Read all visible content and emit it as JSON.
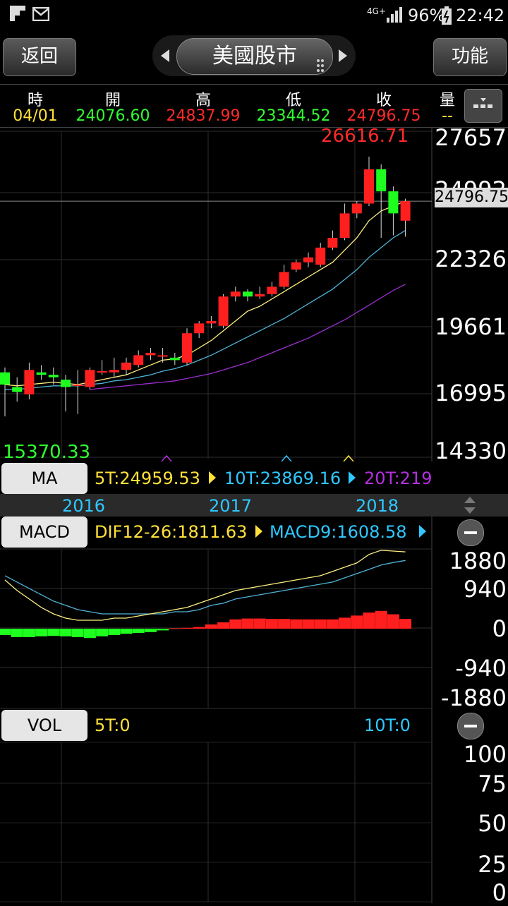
{
  "status": {
    "signal": "4G+",
    "battery": "96%",
    "time": "22:42"
  },
  "nav": {
    "back_label": "返回",
    "title": "美國股市",
    "menu_label": "功能"
  },
  "quote": {
    "headers": [
      "時",
      "開",
      "高",
      "低",
      "收",
      "量"
    ],
    "values": [
      "04/01",
      "24076.60",
      "24837.99",
      "23344.52",
      "24796.75",
      "--"
    ]
  },
  "price_axis": [
    "27657",
    "24992",
    "22326",
    "19661",
    "16995",
    "14330"
  ],
  "current_price": "24796.75",
  "high_label": "26616.71",
  "low_label": "15370.33",
  "ma": {
    "button": "MA",
    "t5": "5T:24959.53",
    "t10": "10T:23869.16",
    "t20": "20T:219"
  },
  "years": [
    "2016",
    "2017",
    "2018"
  ],
  "macd": {
    "button": "MACD",
    "dif": "DIF12-26:1811.63",
    "macd9": "MACD9:1608.58"
  },
  "macd_axis": [
    "1880",
    "940",
    "0",
    "-940",
    "-1880"
  ],
  "vol": {
    "button": "VOL",
    "t5": "5T:0",
    "t10": "10T:0"
  },
  "vol_axis": [
    "100",
    "75",
    "50",
    "25",
    "0"
  ],
  "colors": {
    "up": "#ff1f1f",
    "down": "#1fff1f",
    "ma5": "#ffef80",
    "ma10": "#4fb4d8",
    "ma20": "#9b2fd0",
    "yellow": "#ffe13a",
    "cyan": "#2fc8ff",
    "purple": "#b42fe0"
  },
  "chart_data": {
    "type": "candlestick",
    "title": "",
    "ylim": [
      14330,
      27657
    ],
    "candles": [
      {
        "open": 17800,
        "close": 17300,
        "high": 18000,
        "low": 16000
      },
      {
        "open": 17200,
        "close": 17000,
        "high": 17600,
        "low": 16600
      },
      {
        "open": 16900,
        "close": 17900,
        "high": 18200,
        "low": 16700
      },
      {
        "open": 17800,
        "close": 17700,
        "high": 18100,
        "low": 17500
      },
      {
        "open": 17700,
        "close": 17600,
        "high": 18000,
        "low": 17300
      },
      {
        "open": 17500,
        "close": 17200,
        "high": 17700,
        "low": 16200
      },
      {
        "open": 17300,
        "close": 17300,
        "high": 17900,
        "low": 16100
      },
      {
        "open": 17200,
        "close": 17900,
        "high": 18000,
        "low": 17100
      },
      {
        "open": 17800,
        "close": 17850,
        "high": 18300,
        "low": 17700
      },
      {
        "open": 17800,
        "close": 17900,
        "high": 18400,
        "low": 17600
      },
      {
        "open": 17900,
        "close": 18200,
        "high": 18400,
        "low": 17700
      },
      {
        "open": 18100,
        "close": 18500,
        "high": 18700,
        "low": 18000
      },
      {
        "open": 18500,
        "close": 18600,
        "high": 18800,
        "low": 18300
      },
      {
        "open": 18500,
        "close": 18500,
        "high": 18800,
        "low": 18200
      },
      {
        "open": 18400,
        "close": 18300,
        "high": 18600,
        "low": 18100
      },
      {
        "open": 18200,
        "close": 19400,
        "high": 19600,
        "low": 18100
      },
      {
        "open": 19400,
        "close": 19800,
        "high": 19900,
        "low": 19200
      },
      {
        "open": 19800,
        "close": 19900,
        "high": 20100,
        "low": 19600
      },
      {
        "open": 19700,
        "close": 20900,
        "high": 21000,
        "low": 19600
      },
      {
        "open": 20900,
        "close": 21100,
        "high": 21300,
        "low": 20700
      },
      {
        "open": 21100,
        "close": 20900,
        "high": 21200,
        "low": 20700
      },
      {
        "open": 20900,
        "close": 21000,
        "high": 21300,
        "low": 20800
      },
      {
        "open": 21000,
        "close": 21300,
        "high": 21500,
        "low": 20900
      },
      {
        "open": 21300,
        "close": 21900,
        "high": 22200,
        "low": 21200
      },
      {
        "open": 22000,
        "close": 22300,
        "high": 22400,
        "low": 21900
      },
      {
        "open": 22300,
        "close": 22500,
        "high": 22700,
        "low": 22100
      },
      {
        "open": 22200,
        "close": 22900,
        "high": 23100,
        "low": 22100
      },
      {
        "open": 22900,
        "close": 23300,
        "high": 23600,
        "low": 22800
      },
      {
        "open": 23300,
        "close": 24300,
        "high": 24700,
        "low": 23200
      },
      {
        "open": 24300,
        "close": 24700,
        "high": 24800,
        "low": 24100
      },
      {
        "open": 24700,
        "close": 26100,
        "high": 26616,
        "low": 24600
      },
      {
        "open": 26100,
        "close": 25200,
        "high": 26300,
        "low": 23300
      },
      {
        "open": 25200,
        "close": 24300,
        "high": 25400,
        "low": 23400
      },
      {
        "open": 24000,
        "close": 24796,
        "high": 24900,
        "low": 23344
      }
    ],
    "ma5": [
      17300,
      17250,
      17300,
      17350,
      17400,
      17350,
      17300,
      17400,
      17500,
      17600,
      17700,
      17900,
      18100,
      18300,
      18350,
      18500,
      18800,
      19100,
      19500,
      19900,
      20300,
      20500,
      20800,
      21100,
      21400,
      21700,
      22000,
      22300,
      22800,
      23300,
      24000,
      24400,
      24600,
      24800
    ],
    "ma10": [
      17100,
      17100,
      17150,
      17200,
      17250,
      17250,
      17250,
      17300,
      17350,
      17450,
      17500,
      17600,
      17700,
      17850,
      17950,
      18100,
      18300,
      18500,
      18750,
      19000,
      19250,
      19500,
      19750,
      20000,
      20300,
      20600,
      20900,
      21200,
      21600,
      22000,
      22500,
      22900,
      23300,
      23600
    ],
    "ma20": [
      null,
      null,
      null,
      null,
      null,
      null,
      null,
      17100,
      17150,
      17200,
      17250,
      17300,
      17350,
      17400,
      17450,
      17550,
      17650,
      17750,
      17900,
      18050,
      18200,
      18400,
      18600,
      18800,
      19000,
      19200,
      19450,
      19700,
      19950,
      20250,
      20550,
      20850,
      21150,
      21400
    ],
    "macd_ylim": [
      -1880,
      1880
    ],
    "macd_dif": [
      1150,
      900,
      700,
      500,
      350,
      250,
      200,
      200,
      200,
      250,
      250,
      300,
      350,
      400,
      450,
      500,
      600,
      700,
      800,
      900,
      950,
      1000,
      1050,
      1100,
      1150,
      1200,
      1250,
      1350,
      1450,
      1550,
      1750,
      1850,
      1830,
      1811
    ],
    "macd_dea": [
      1250,
      1100,
      950,
      800,
      650,
      550,
      450,
      400,
      350,
      350,
      350,
      350,
      350,
      350,
      400,
      400,
      450,
      550,
      600,
      700,
      750,
      800,
      850,
      900,
      950,
      1000,
      1050,
      1100,
      1200,
      1300,
      1400,
      1500,
      1560,
      1608
    ],
    "macd_hist": [
      -150,
      -200,
      -200,
      -180,
      -170,
      -180,
      -200,
      -220,
      -180,
      -150,
      -120,
      -100,
      -80,
      -40,
      10,
      20,
      40,
      100,
      150,
      220,
      240,
      240,
      230,
      230,
      220,
      220,
      220,
      220,
      260,
      310,
      380,
      420,
      340,
      230
    ],
    "vol_ylim": [
      0,
      100
    ],
    "volumes": []
  }
}
